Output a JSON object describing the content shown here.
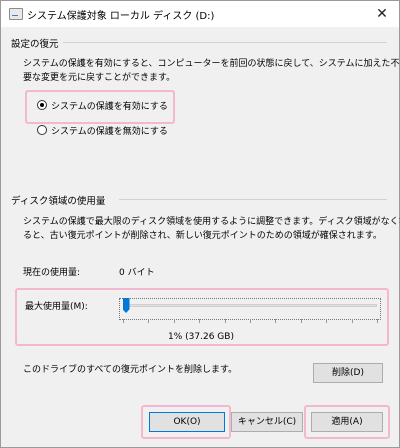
{
  "window": {
    "title": "システム保護対象 ローカル ディスク (D:)",
    "close_symbol": "✕"
  },
  "restore": {
    "group_title": "設定の復元",
    "description": [
      "システムの保護を有効にすると、コンピューターを前回の状態に戻して、システムに加えた不",
      "要な変更を元に戻すことができます。"
    ],
    "options": [
      {
        "label": "システムの保護を有効にする",
        "selected": true
      },
      {
        "label": "システムの保護を無効にする",
        "selected": false
      }
    ]
  },
  "disk": {
    "group_title": "ディスク領域の使用量",
    "description": [
      "システムの保護で最大限のディスク領域を使用するように調整できます。ディスク領域がなくな",
      "ると、古い復元ポイントが削除され、新しい復元ポイントのための領域が確保されます。"
    ],
    "current_label": "現在の使用量:",
    "current_value": "0 バイト",
    "max_label": "最大使用量(M):",
    "slider_percent": 1,
    "slider_caption": "1% (37.26 GB)",
    "delete_text": "このドライブのすべての復元ポイントを削除します。",
    "delete_button": "削除(D)"
  },
  "buttons": {
    "ok": "OK(O)",
    "cancel": "キャンセル(C)",
    "apply": "適用(A)"
  },
  "colors": {
    "accent": "#0078d7",
    "highlight": "#f3b7cf"
  }
}
